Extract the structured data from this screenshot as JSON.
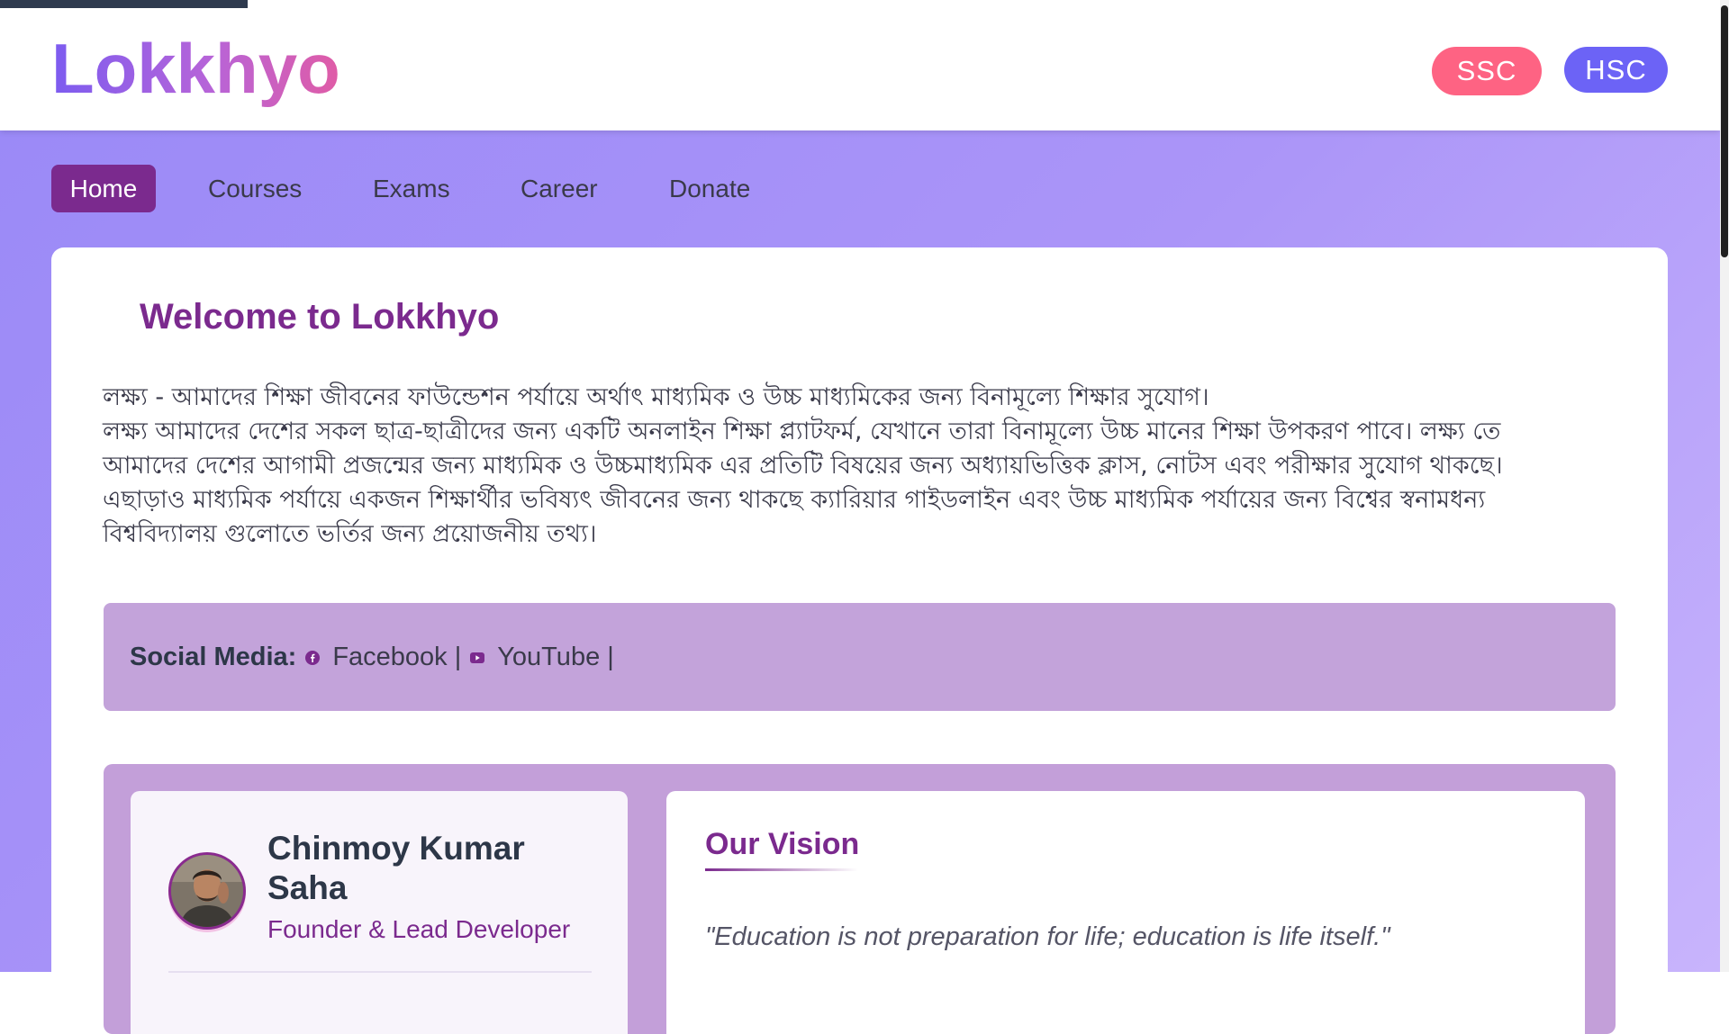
{
  "brand": {
    "logo_text": "Lokkhyo"
  },
  "header": {
    "buttons": [
      {
        "label": "SSC"
      },
      {
        "label": "HSC"
      }
    ]
  },
  "nav": {
    "items": [
      {
        "label": "Home",
        "active": true
      },
      {
        "label": "Courses"
      },
      {
        "label": "Exams"
      },
      {
        "label": "Career"
      },
      {
        "label": "Donate"
      }
    ]
  },
  "welcome": {
    "title": "Welcome to Lokkhyo",
    "lines": [
      "লক্ষ্য - আমাদের শিক্ষা জীবনের ফাউন্ডেশন পর্যায়ে অর্থাৎ মাধ্যমিক ও উচ্চ মাধ্যমিকের জন্য বিনামূল্যে শিক্ষার সুযোগ।",
      "লক্ষ্য আমাদের দেশের সকল ছাত্র-ছাত্রীদের জন্য একটি অনলাইন শিক্ষা প্ল্যাটফর্ম, যেখানে তারা বিনামূল্যে উচ্চ মানের শিক্ষা উপকরণ পাবে। লক্ষ্য তে",
      "আমাদের দেশের আগামী প্রজন্মের জন্য মাধ্যমিক ও উচ্চমাধ্যমিক এর প্রতিটি বিষয়ের জন্য অধ্যায়ভিত্তিক ক্লাস, নোটস এবং পরীক্ষার সুযোগ থাকছে।",
      "এছাড়াও মাধ্যমিক পর্যায়ে একজন শিক্ষার্থীর ভবিষ্যৎ জীবনের জন্য থাকছে ক্যারিয়ার গাইডলাইন এবং উচ্চ মাধ্যমিক পর্যায়ের জন্য বিশ্বের স্বনামধন্য",
      "বিশ্ববিদ্যালয় গুলোতে ভর্তির জন্য প্রয়োজনীয় তথ্য।"
    ]
  },
  "social": {
    "label": "Social Media:",
    "separator": "|",
    "links": [
      {
        "label": "Facebook",
        "icon": "facebook-icon"
      },
      {
        "label": "YouTube",
        "icon": "youtube-icon"
      }
    ]
  },
  "founder": {
    "name": "Chinmoy Kumar Saha",
    "role": "Founder & Lead Developer"
  },
  "vision": {
    "title": "Our Vision",
    "quote": "\"Education is not preparation for life; education is life itself.\""
  },
  "colors": {
    "accent_purple": "#7b2a8e",
    "ssc_pink": "#fe6383",
    "hsc_indigo": "#6c63f6",
    "background_violet": "#ab95f8"
  }
}
